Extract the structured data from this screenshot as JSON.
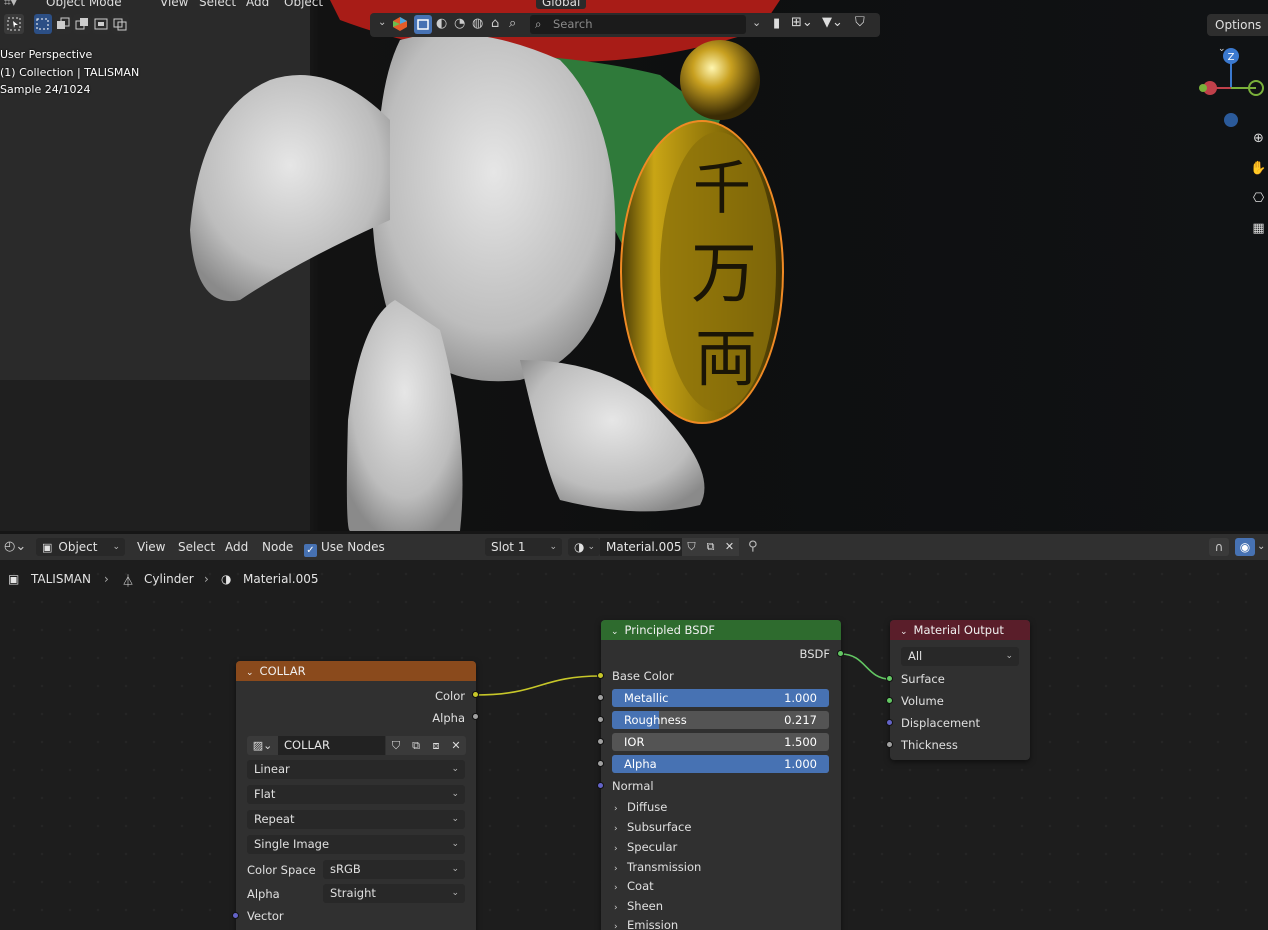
{
  "viewport": {
    "menu": [
      "View",
      "Select",
      "Add",
      "Object"
    ],
    "mode": "Object Mode",
    "transform_orientation": "Global",
    "search_placeholder": "Search",
    "options_label": "Options",
    "overlay_lines": [
      "User Perspective",
      "(1) Collection | TALISMAN",
      "Sample 24/1024"
    ],
    "gizmo_axis_label": "Z",
    "coin_glyphs": [
      "千",
      "万",
      "両"
    ]
  },
  "node_editor": {
    "header": {
      "editor_type": "Object",
      "menu": [
        "View",
        "Select",
        "Add",
        "Node"
      ],
      "use_nodes_label": "Use Nodes",
      "slot": "Slot 1",
      "material": "Material.005"
    },
    "breadcrumb": [
      "TALISMAN",
      "Cylinder",
      "Material.005"
    ],
    "nodes": {
      "collar": {
        "title": "COLLAR",
        "outputs": [
          "Color",
          "Alpha"
        ],
        "image_name": "COLLAR",
        "interpolation": "Linear",
        "projection": "Flat",
        "extension": "Repeat",
        "source": "Single Image",
        "color_space_label": "Color Space",
        "color_space": "sRGB",
        "alpha_label": "Alpha",
        "alpha_mode": "Straight",
        "input_vector": "Vector"
      },
      "principled": {
        "title": "Principled BSDF",
        "output": "BSDF",
        "base_color": "Base Color",
        "sliders": [
          {
            "label": "Metallic",
            "value": "1.000",
            "fill": 1.0
          },
          {
            "label": "Roughness",
            "value": "0.217",
            "fill": 0.217
          },
          {
            "label": "IOR",
            "value": "1.500",
            "fill": 0.0
          },
          {
            "label": "Alpha",
            "value": "1.000",
            "fill": 1.0
          }
        ],
        "normal": "Normal",
        "panels": [
          "Diffuse",
          "Subsurface",
          "Specular",
          "Transmission",
          "Coat",
          "Sheen",
          "Emission"
        ]
      },
      "output": {
        "title": "Material Output",
        "target": "All",
        "inputs": [
          "Surface",
          "Volume",
          "Displacement",
          "Thickness"
        ]
      }
    }
  },
  "colors": {
    "collar_header": "#8a4a1c",
    "bsdf_header": "#2e6b2e",
    "output_header": "#5a1e2a",
    "accent": "#4772b3",
    "selection_outline": "#f08a24"
  }
}
